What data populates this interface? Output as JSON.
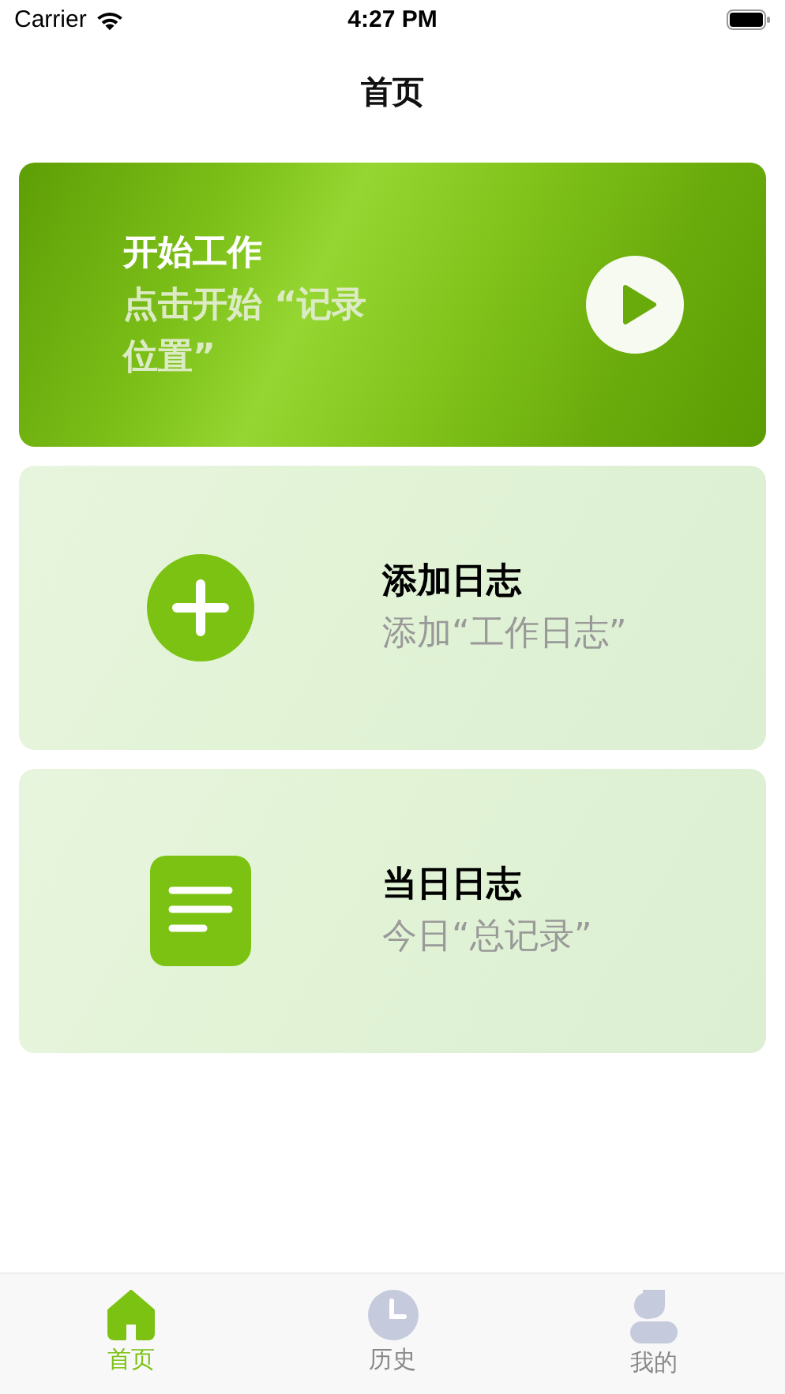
{
  "status_bar": {
    "carrier": "Carrier",
    "time": "4:27 PM"
  },
  "nav": {
    "title": "首页"
  },
  "cards": [
    {
      "kind": "start",
      "title": "开始工作",
      "subtitle": "点击开始 “记录位置”"
    },
    {
      "kind": "add",
      "title": "添加日志",
      "subtitle": "添加“工作日志”"
    },
    {
      "kind": "log",
      "title": "当日日志",
      "subtitle": "今日“总记录”"
    }
  ],
  "tabs": [
    {
      "kind": "home",
      "label": "首页",
      "selected": true
    },
    {
      "kind": "history",
      "label": "历史",
      "selected": false
    },
    {
      "kind": "profile",
      "label": "我的",
      "selected": false
    }
  ]
}
